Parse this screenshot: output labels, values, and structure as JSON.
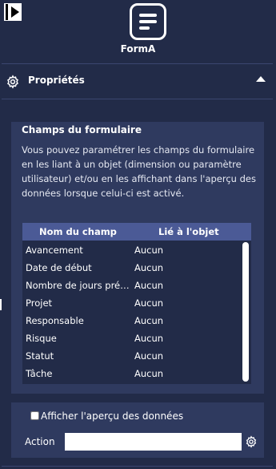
{
  "app": {
    "title": "FormA",
    "icon": "form-lines-icon"
  },
  "top": {
    "expand_icon": "play-panel-icon"
  },
  "section": {
    "title": "Propriétés",
    "icon": "gear-icon",
    "toggle_icon": "chevron-up-icon"
  },
  "fields_panel": {
    "title": "Champs du formulaire",
    "description": "Vous pouvez paramétrer les champs du formulaire en les liant à un objet (dimension ou paramètre utilisateur) et/ou en les affichant dans l'aperçu des données lorsque celui-ci est activé.",
    "columns": [
      "Nom du champ",
      "Lié à l'objet"
    ],
    "rows": [
      {
        "name": "Avancement",
        "linked": "Aucun"
      },
      {
        "name": "Date de début",
        "linked": "Aucun"
      },
      {
        "name": "Nombre de jours prévus",
        "linked": "Aucun"
      },
      {
        "name": "Projet",
        "linked": "Aucun"
      },
      {
        "name": "Responsable",
        "linked": "Aucun"
      },
      {
        "name": "Risque",
        "linked": "Aucun"
      },
      {
        "name": "Statut",
        "linked": "Aucun"
      },
      {
        "name": "Tâche",
        "linked": "Aucun"
      }
    ]
  },
  "preview_panel": {
    "checkbox_label": "Afficher l'aperçu des données",
    "checked": false,
    "action_label": "Action",
    "action_value": "",
    "action_icon": "gear-icon"
  },
  "colors": {
    "background": "#222b48",
    "panel": "#2f3a5f",
    "table_header": "#4b5a96",
    "text": "#ffffff"
  }
}
